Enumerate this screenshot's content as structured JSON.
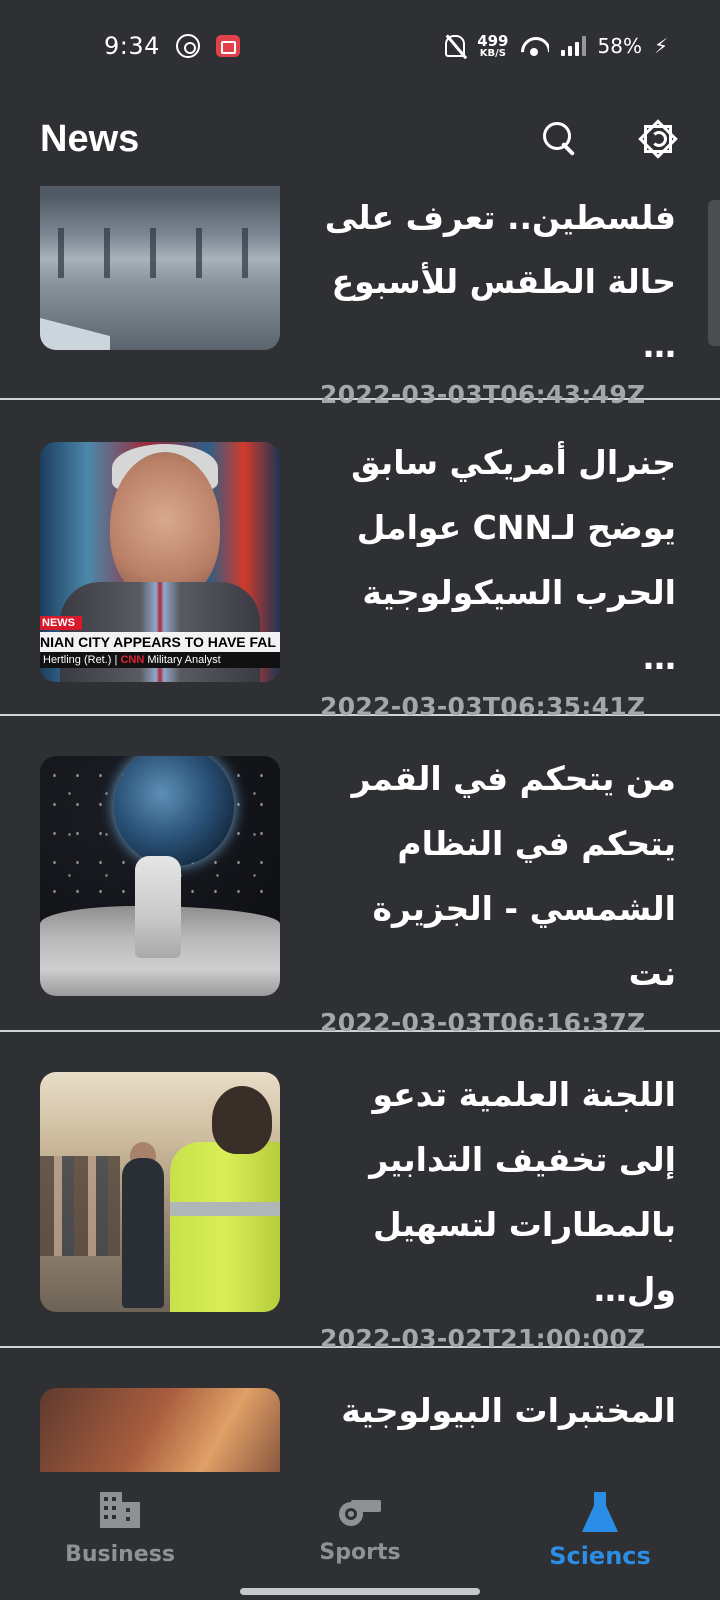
{
  "status_bar": {
    "time": "9:34",
    "net_speed_value": "499",
    "net_speed_unit": "KB/S",
    "battery": "58%",
    "icons": [
      "whatsapp-icon",
      "screen-record-icon",
      "bell-off-icon",
      "wifi-icon",
      "signal-icon",
      "charging-icon"
    ]
  },
  "app_bar": {
    "title": "News",
    "icons": [
      "search-icon",
      "theme-toggle-icon"
    ]
  },
  "articles": [
    {
      "title": "فلسطين.. تعرف على حالة الطقس للأسبوع …",
      "date": "2022-03-03T06:43:49Z"
    },
    {
      "title": "جنرال أمريكي سابق يوضح لـCNN عوامل الحرب السيكولوجية …",
      "date": "2022-03-03T06:35:41Z"
    },
    {
      "title": "من يتحكم في القمر يتحكم في النظام الشمسي - الجزيرة نت",
      "date": "2022-03-03T06:16:37Z"
    },
    {
      "title": "اللجنة العلمية تدعو إلى تخفيف التدابير بالمطارات لتسهيل ول…",
      "date": "2022-03-02T21:00:00Z"
    },
    {
      "title": "المختبرات البيولوجية",
      "date": ""
    }
  ],
  "thumb_text": {
    "news_bug": "NEWS",
    "headline": "NIAN CITY APPEARS TO HAVE FAL",
    "name": "Hertling (Ret.)",
    "network": "CNN",
    "role": "Military Analyst"
  },
  "bottom_nav": {
    "items": [
      {
        "label": "Business",
        "icon": "building-icon"
      },
      {
        "label": "Sports",
        "icon": "whistle-icon"
      },
      {
        "label": "Sciencs",
        "icon": "flask-icon"
      }
    ],
    "active_index": 2,
    "active_color": "#2b8de6",
    "inactive_color": "#8e9196"
  }
}
